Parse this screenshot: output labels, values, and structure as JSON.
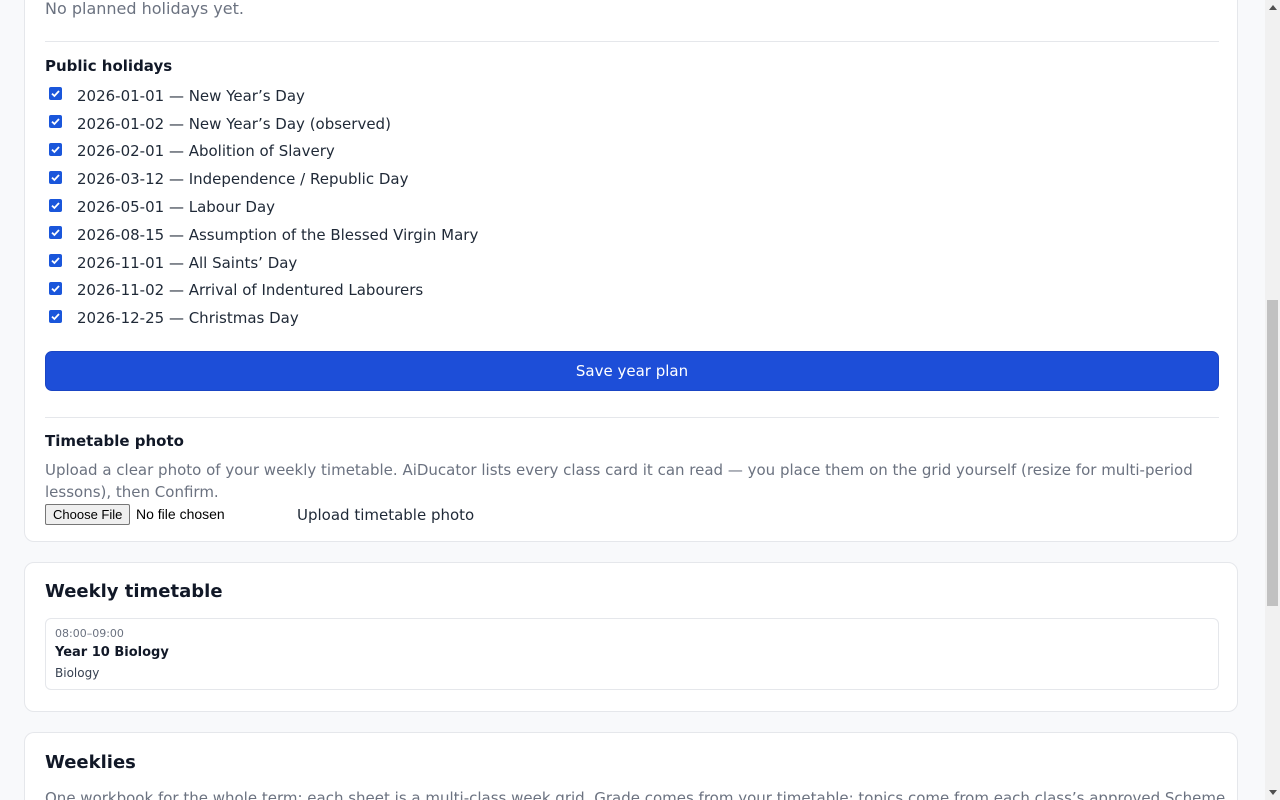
{
  "year_plan": {
    "empty_planned": "No planned holidays yet.",
    "public_holidays_title": "Public holidays",
    "public_holidays": [
      {
        "label": "2026-01-01 — New Year’s Day",
        "checked": true
      },
      {
        "label": "2026-01-02 — New Year’s Day (observed)",
        "checked": true
      },
      {
        "label": "2026-02-01 — Abolition of Slavery",
        "checked": true
      },
      {
        "label": "2026-03-12 — Independence / Republic Day",
        "checked": true
      },
      {
        "label": "2026-05-01 — Labour Day",
        "checked": true
      },
      {
        "label": "2026-08-15 — Assumption of the Blessed Virgin Mary",
        "checked": true
      },
      {
        "label": "2026-11-01 — All Saints’ Day",
        "checked": true
      },
      {
        "label": "2026-11-02 — Arrival of Indentured Labourers",
        "checked": true
      },
      {
        "label": "2026-12-25 — Christmas Day",
        "checked": true
      }
    ],
    "save_label": "Save year plan"
  },
  "timetable_photo": {
    "title": "Timetable photo",
    "description": "Upload a clear photo of your weekly timetable. AiDucator lists every class card it can read — you place them on the grid yourself (resize for multi-period lessons), then Confirm.",
    "choose_file_label": "Choose File",
    "file_status": "No file chosen",
    "upload_label": "Upload timetable photo"
  },
  "weekly_timetable": {
    "title": "Weekly timetable",
    "slots": [
      {
        "time": "08:00–09:00",
        "class_name": "Year 10 Biology",
        "subject": "Biology"
      }
    ]
  },
  "weeklies": {
    "title": "Weeklies",
    "description": "One workbook for the whole term: each sheet is a multi-class week grid. Grade comes from your timetable; topics come from each class’s approved Scheme of Work."
  },
  "colors": {
    "accent": "#1d4ed8",
    "checkbox": "#1a56db",
    "muted_text": "#6b7280"
  }
}
